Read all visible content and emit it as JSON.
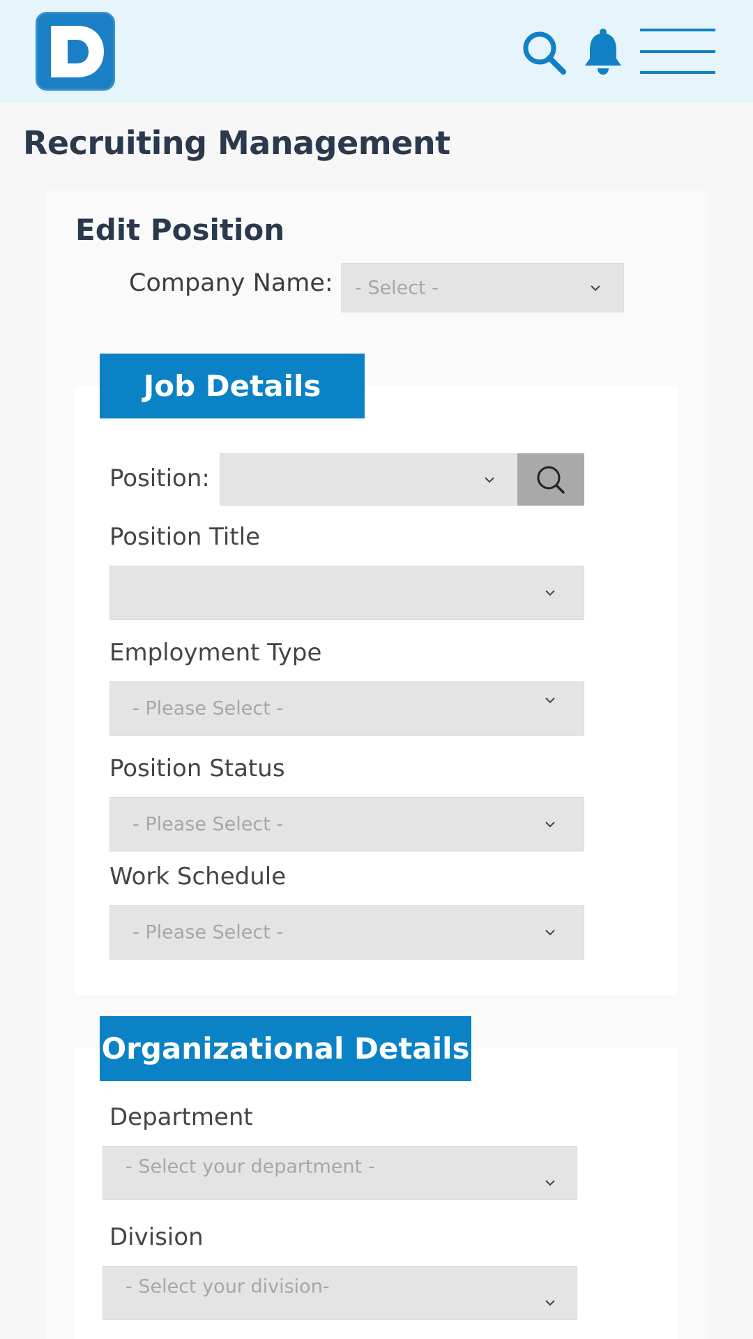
{
  "header": {
    "logo_icon": "d-logo-icon",
    "icons": [
      "search-icon",
      "bell-icon",
      "hamburger-menu-icon"
    ],
    "accent_color": "#0b82c5"
  },
  "page": {
    "title": "Recruiting Management"
  },
  "form": {
    "title": "Edit Position",
    "company": {
      "label": "Company Name:",
      "placeholder": "- Select -"
    },
    "job_details": {
      "tab_label": "Job Details",
      "position": {
        "label": "Position:",
        "value": ""
      },
      "position_title": {
        "label": "Position Title",
        "value": ""
      },
      "employment_type": {
        "label": "Employment Type",
        "placeholder": "- Please Select -"
      },
      "position_status": {
        "label": "Position Status",
        "placeholder": "- Please Select -"
      },
      "work_schedule": {
        "label": "Work Schedule",
        "placeholder": "- Please Select -"
      }
    },
    "organizational_details": {
      "tab_label": "Organizational Details",
      "department": {
        "label": "Department",
        "placeholder": "- Select your department -"
      },
      "division": {
        "label": "Division",
        "placeholder": "- Select your division-"
      }
    }
  }
}
